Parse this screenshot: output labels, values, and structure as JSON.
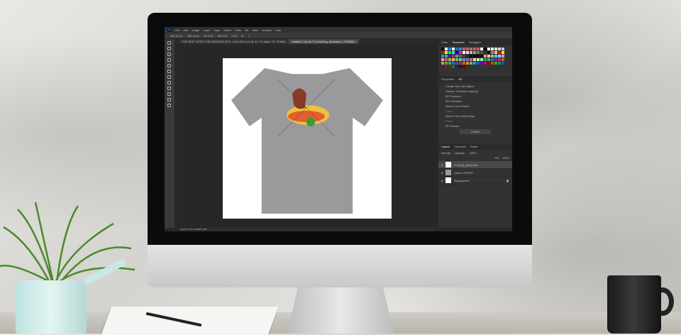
{
  "menu": [
    "File",
    "Edit",
    "Image",
    "Layer",
    "Type",
    "Select",
    "Filter",
    "3D",
    "View",
    "Window",
    "Help"
  ],
  "options": {
    "x": "500,00 px",
    "y": "350,00 px",
    "w": "66,67%",
    "h": "66,67%",
    "angle": "0,00"
  },
  "tabs": [
    "TOP BEST APPS FOR ANDROID BOX, 1024x512.psd @ 41,7% (layer 15, RGB/8)",
    "Untitled-2 @ 66,7% (HotDog_illustration, RGB/8#) *"
  ],
  "panels": {
    "top_tabs": [
      "Color",
      "Swatches",
      "Navigator"
    ],
    "props_tabs": [
      "Properties",
      "3D"
    ],
    "create_title": "Create New 3D Object",
    "source_label": "Source:",
    "source_value": "Selected Layer(s)",
    "options": [
      "3D Postcard",
      "3D Extrusion",
      "Mesh From Preset",
      "Cone",
      "Mesh From Depth Map",
      "Plane",
      "3D Volume"
    ],
    "create_button": "Create",
    "layers_tabs": [
      "Layers",
      "Channels",
      "Paths"
    ],
    "blend_mode": "Normal",
    "opacity_label": "Opacity:",
    "opacity": "100%",
    "fill_label": "Fill:",
    "fill": "100%",
    "layers": [
      "HotDog_illustration",
      "Mask #TSHIRT",
      "Background"
    ]
  },
  "status": {
    "zoom": "66,67%",
    "doc": "Doc: 2,64M/5,13M"
  },
  "swatch_colors": [
    "#000",
    "#fff",
    "#1e90ff",
    "#fff",
    "#1e6fd0",
    "#2d8cf0",
    "#c86464",
    "#c86464",
    "#c86464",
    "#c86464",
    "#c86464",
    "#fff",
    "#000",
    "#fff",
    "#fff",
    "#eee",
    "#ddd",
    "#ccc",
    "#f00",
    "#ff0",
    "#0f0",
    "#0ff",
    "#00f",
    "#f0f",
    "#fff",
    "#ddd",
    "#bbb",
    "#999",
    "#777",
    "#555",
    "#333",
    "#111",
    "#f66",
    "#fc6",
    "#f00",
    "#ff0",
    "#2a6",
    "#2ae",
    "#23a",
    "#a2a",
    "#888",
    "#666",
    "#444",
    "#222",
    "#000",
    "#000",
    "#000",
    "#000",
    "#f96",
    "#fc9",
    "#9c6",
    "#6cf",
    "#9cf",
    "#c9f",
    "#f9c",
    "#c66",
    "#c96",
    "#cc6",
    "#6c6",
    "#6cc",
    "#69c",
    "#96c",
    "#c69",
    "#fcc",
    "#cf9",
    "#9fc",
    "#3a3",
    "#3aa",
    "#36a",
    "#63a",
    "#a36",
    "#a63",
    "#aa3",
    "#6a3",
    "#3a6",
    "#36c",
    "#639",
    "#936",
    "#c60",
    "#c90",
    "#3c9",
    "#39c",
    "#06c",
    "#60c",
    "#c06",
    "#900",
    "#960",
    "#690",
    "#096",
    "#069",
    "#609",
    "#906",
    "#630",
    "#363",
    "#036",
    "#303",
    "#600",
    "#333"
  ]
}
